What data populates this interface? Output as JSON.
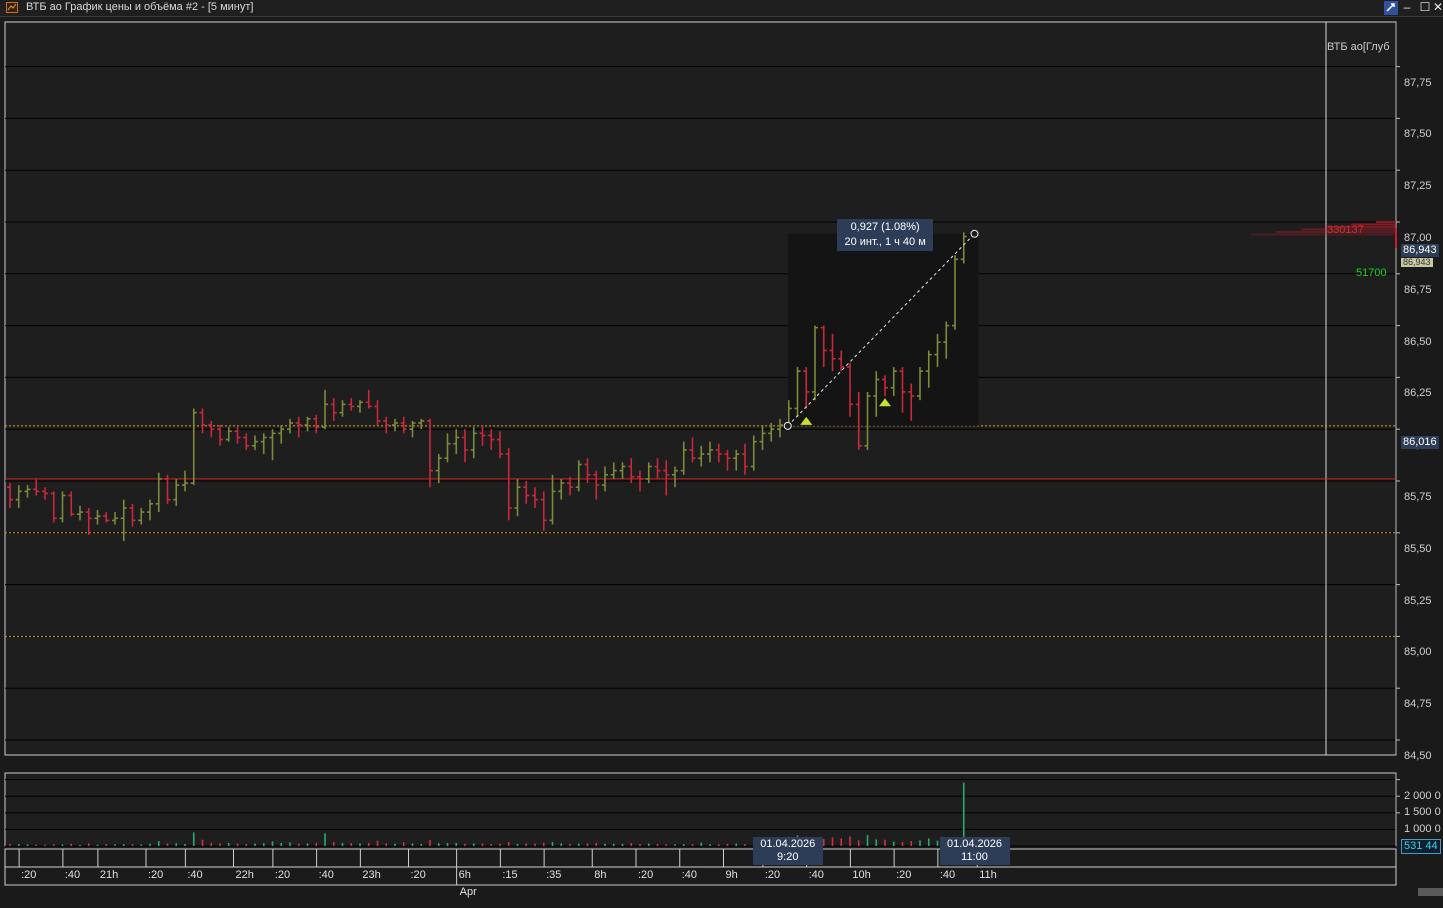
{
  "window": {
    "title": "ВТБ ао График цены и объёма #2 - [5 минут]",
    "minimize": "–",
    "maximize": "☐",
    "close": "✕"
  },
  "chart_data": {
    "type": "ohlc",
    "instrument": "ВТБ ао",
    "interval": "5 минут",
    "ylim": [
      84.4,
      87.8
    ],
    "yticks": [
      "87,75",
      "87,50",
      "87,25",
      "87,00",
      "86,75",
      "86,50",
      "86,25",
      "86,00",
      "85,75",
      "85,50",
      "85,25",
      "85,00",
      "84,75",
      "84,50"
    ],
    "ytick_values": [
      87.75,
      87.5,
      87.25,
      87.0,
      86.75,
      86.5,
      86.25,
      86.0,
      85.75,
      85.5,
      85.25,
      85.0,
      84.75,
      84.5
    ],
    "bars": [
      [
        85.72,
        85.74,
        85.62,
        85.66
      ],
      [
        85.66,
        85.73,
        85.62,
        85.7
      ],
      [
        85.7,
        85.73,
        85.67,
        85.71
      ],
      [
        85.71,
        85.76,
        85.68,
        85.7
      ],
      [
        85.7,
        85.72,
        85.66,
        85.69
      ],
      [
        85.69,
        85.7,
        85.55,
        85.57
      ],
      [
        85.57,
        85.7,
        85.55,
        85.68
      ],
      [
        85.68,
        85.7,
        85.58,
        85.59
      ],
      [
        85.59,
        85.63,
        85.56,
        85.6
      ],
      [
        85.6,
        85.62,
        85.49,
        85.57
      ],
      [
        85.57,
        85.61,
        85.54,
        85.58
      ],
      [
        85.58,
        85.6,
        85.55,
        85.56
      ],
      [
        85.56,
        85.6,
        85.54,
        85.57
      ],
      [
        85.57,
        85.66,
        85.46,
        85.62
      ],
      [
        85.62,
        85.64,
        85.53,
        85.56
      ],
      [
        85.56,
        85.62,
        85.54,
        85.6
      ],
      [
        85.6,
        85.66,
        85.56,
        85.64
      ],
      [
        85.64,
        85.79,
        85.6,
        85.76
      ],
      [
        85.76,
        85.78,
        85.64,
        85.66
      ],
      [
        85.66,
        85.76,
        85.63,
        85.73
      ],
      [
        85.73,
        85.8,
        85.7,
        85.74
      ],
      [
        85.74,
        86.1,
        85.73,
        86.08
      ],
      [
        86.08,
        86.1,
        85.98,
        86.02
      ],
      [
        86.02,
        86.04,
        85.96,
        86.0
      ],
      [
        86.0,
        86.02,
        85.92,
        85.95
      ],
      [
        85.95,
        86.01,
        85.94,
        85.99
      ],
      [
        85.99,
        86.01,
        85.93,
        85.96
      ],
      [
        85.96,
        85.98,
        85.9,
        85.92
      ],
      [
        85.92,
        85.97,
        85.9,
        85.94
      ],
      [
        85.94,
        85.98,
        85.88,
        85.96
      ],
      [
        85.96,
        86.0,
        85.85,
        85.98
      ],
      [
        85.98,
        86.02,
        85.93,
        86.0
      ],
      [
        86.0,
        86.05,
        85.98,
        86.03
      ],
      [
        86.03,
        86.06,
        85.96,
        86.02
      ],
      [
        86.02,
        86.06,
        85.99,
        86.05
      ],
      [
        86.05,
        86.07,
        85.98,
        86.01
      ],
      [
        86.01,
        86.19,
        86.0,
        86.12
      ],
      [
        86.12,
        86.15,
        86.04,
        86.08
      ],
      [
        86.08,
        86.14,
        86.06,
        86.12
      ],
      [
        86.12,
        86.15,
        86.09,
        86.11
      ],
      [
        86.11,
        86.14,
        86.08,
        86.13
      ],
      [
        86.13,
        86.19,
        86.1,
        86.11
      ],
      [
        86.11,
        86.14,
        86.02,
        86.04
      ],
      [
        86.04,
        86.06,
        85.98,
        86.02
      ],
      [
        86.02,
        86.05,
        85.99,
        86.03
      ],
      [
        86.03,
        86.06,
        85.98,
        86.0
      ],
      [
        86.0,
        86.04,
        85.96,
        86.03
      ],
      [
        86.03,
        86.05,
        86.0,
        86.04
      ],
      [
        86.04,
        86.05,
        85.72,
        85.8
      ],
      [
        85.8,
        85.88,
        85.74,
        85.86
      ],
      [
        85.86,
        85.98,
        85.84,
        85.93
      ],
      [
        85.93,
        86.0,
        85.88,
        85.96
      ],
      [
        85.96,
        86.0,
        85.84,
        85.9
      ],
      [
        85.9,
        86.01,
        85.86,
        85.98
      ],
      [
        85.98,
        86.02,
        85.92,
        85.97
      ],
      [
        85.97,
        86.0,
        85.9,
        85.95
      ],
      [
        85.95,
        85.99,
        85.86,
        85.88
      ],
      [
        85.88,
        85.91,
        85.56,
        85.62
      ],
      [
        85.62,
        85.76,
        85.58,
        85.72
      ],
      [
        85.72,
        85.75,
        85.64,
        85.68
      ],
      [
        85.68,
        85.72,
        85.62,
        85.66
      ],
      [
        85.66,
        85.7,
        85.51,
        85.56
      ],
      [
        85.56,
        85.78,
        85.54,
        85.7
      ],
      [
        85.7,
        85.76,
        85.66,
        85.74
      ],
      [
        85.74,
        85.77,
        85.68,
        85.72
      ],
      [
        85.72,
        85.85,
        85.7,
        85.83
      ],
      [
        85.83,
        85.86,
        85.74,
        85.78
      ],
      [
        85.78,
        85.8,
        85.66,
        85.73
      ],
      [
        85.73,
        85.82,
        85.7,
        85.78
      ],
      [
        85.78,
        85.84,
        85.76,
        85.8
      ],
      [
        85.8,
        85.84,
        85.76,
        85.82
      ],
      [
        85.82,
        85.86,
        85.74,
        85.77
      ],
      [
        85.77,
        85.8,
        85.7,
        85.76
      ],
      [
        85.76,
        85.84,
        85.74,
        85.82
      ],
      [
        85.82,
        85.86,
        85.76,
        85.8
      ],
      [
        85.8,
        85.85,
        85.68,
        85.78
      ],
      [
        85.78,
        85.82,
        85.72,
        85.8
      ],
      [
        85.8,
        85.94,
        85.78,
        85.9
      ],
      [
        85.9,
        85.96,
        85.84,
        85.86
      ],
      [
        85.86,
        85.92,
        85.82,
        85.88
      ],
      [
        85.88,
        85.94,
        85.84,
        85.9
      ],
      [
        85.9,
        85.93,
        85.84,
        85.88
      ],
      [
        85.88,
        85.9,
        85.8,
        85.86
      ],
      [
        85.86,
        85.9,
        85.8,
        85.88
      ],
      [
        85.88,
        85.93,
        85.78,
        85.82
      ],
      [
        85.82,
        85.97,
        85.8,
        85.94
      ],
      [
        85.94,
        86.02,
        85.9,
        85.98
      ],
      [
        85.98,
        86.03,
        85.94,
        86.0
      ],
      [
        86.0,
        86.05,
        85.96,
        86.02
      ],
      [
        86.02,
        86.14,
        86.0,
        86.1
      ],
      [
        86.1,
        86.3,
        86.06,
        86.28
      ],
      [
        86.28,
        86.3,
        86.1,
        86.18
      ],
      [
        86.18,
        86.5,
        86.14,
        86.49
      ],
      [
        86.49,
        86.5,
        86.3,
        86.38
      ],
      [
        86.38,
        86.46,
        86.28,
        86.34
      ],
      [
        86.34,
        86.38,
        86.28,
        86.3
      ],
      [
        86.3,
        86.32,
        86.06,
        86.12
      ],
      [
        86.12,
        86.18,
        85.9,
        85.92
      ],
      [
        85.92,
        86.18,
        85.9,
        86.16
      ],
      [
        86.16,
        86.28,
        86.06,
        86.24
      ],
      [
        86.24,
        86.26,
        86.16,
        86.2
      ],
      [
        86.2,
        86.3,
        86.16,
        86.28
      ],
      [
        86.28,
        86.3,
        86.08,
        86.18
      ],
      [
        86.18,
        86.22,
        86.04,
        86.16
      ],
      [
        86.16,
        86.3,
        86.14,
        86.28
      ],
      [
        86.28,
        86.38,
        86.2,
        86.36
      ],
      [
        86.36,
        86.46,
        86.3,
        86.42
      ],
      [
        86.42,
        86.52,
        86.34,
        86.5
      ],
      [
        86.5,
        86.84,
        86.48,
        86.82
      ],
      [
        86.82,
        86.95,
        86.8,
        86.93
      ]
    ],
    "volumes": [
      60,
      55,
      50,
      45,
      40,
      55,
      45,
      70,
      35,
      80,
      40,
      60,
      50,
      55,
      60,
      45,
      70,
      150,
      80,
      85,
      60,
      410,
      190,
      100,
      80,
      90,
      70,
      60,
      75,
      85,
      140,
      90,
      110,
      70,
      80,
      100,
      380,
      120,
      95,
      90,
      80,
      95,
      160,
      85,
      70,
      110,
      80,
      60,
      180,
      85,
      90,
      95,
      70,
      80,
      75,
      60,
      70,
      120,
      65,
      80,
      75,
      100,
      120,
      80,
      60,
      75,
      80,
      95,
      70,
      70,
      65,
      90,
      60,
      75,
      60,
      55,
      50,
      55,
      60,
      100,
      55,
      55,
      65,
      75,
      60,
      90,
      80,
      70,
      95,
      280,
      320,
      280,
      190,
      210,
      260,
      230,
      290,
      170,
      330,
      200,
      190,
      130,
      120,
      150,
      170,
      230,
      160,
      190,
      190,
      1910
    ],
    "h_lines": [
      {
        "value": 85.76,
        "style": "solid",
        "color": "#d02020"
      },
      {
        "value": 86.016,
        "style": "dotted",
        "color": "#e8a020"
      },
      {
        "value": 85.5,
        "style": "dotted",
        "color": "#e8a020"
      },
      {
        "value": 85.0,
        "style": "dotted",
        "color": "#e8a020"
      }
    ],
    "last_price_label": "86,943",
    "level_label": "86,016",
    "orderbook_ask_volume": "330137",
    "orderbook_bid_volume": "51700",
    "orderbook_header": "ВТБ ао[Глуб",
    "measure": {
      "change": "0,927 (1.08%)",
      "duration": "20 инт., 1 ч 40 м",
      "start_bar": 89,
      "end_bar": 110,
      "start_price": 86.016,
      "end_price": 86.943
    },
    "signals": [
      {
        "bar": 91,
        "price": 86.04
      },
      {
        "bar": 100,
        "price": 86.13
      }
    ],
    "volume_axis": {
      "ticks": [
        "2 000 0",
        "1 500 0",
        "1 000 0"
      ],
      "tick_values": [
        2000,
        1500,
        1000
      ],
      "current": "531 44",
      "current_value": 531
    },
    "time_labels": [
      ":20",
      ":40",
      "21h",
      ":20",
      ":40",
      "22h",
      ":20",
      ":40",
      "23h",
      ":20",
      "6h",
      ":15",
      ":35",
      "8h",
      ":20",
      ":40",
      "9h",
      ":20",
      ":40",
      "10h",
      ":20",
      ":40",
      "11h"
    ],
    "month_label": "Apr",
    "crosshair_start": {
      "date": "01.04.2026",
      "time": "9:20"
    },
    "crosshair_end": {
      "date": "01.04.2026",
      "time": "11:00"
    },
    "colors": {
      "up": "#7c8a3a",
      "down": "#c8283c",
      "volume_up": "#2aa870",
      "volume_down": "#d03040",
      "signal": "#c8e030"
    }
  }
}
